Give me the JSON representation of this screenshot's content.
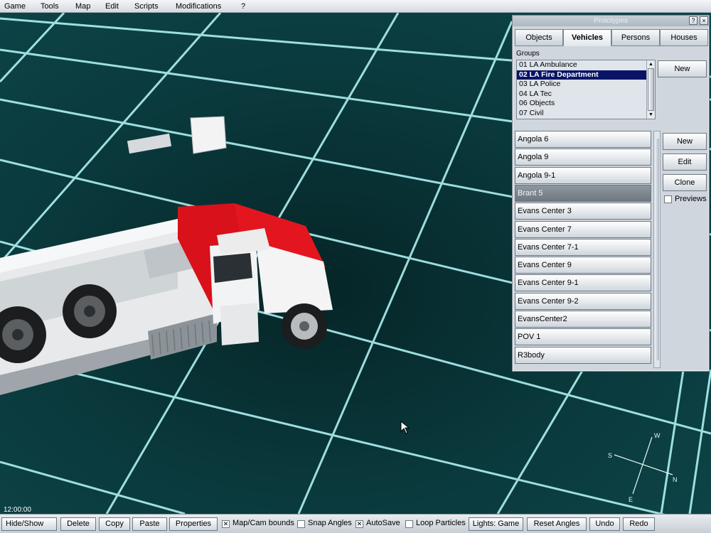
{
  "menu": [
    "Game",
    "Tools",
    "Map",
    "Edit",
    "Scripts",
    "Modifications",
    "?"
  ],
  "panel": {
    "title": "Prototypes",
    "help_glyph": "?",
    "close_glyph": "×",
    "tabs": [
      "Objects",
      "Vehicles",
      "Persons",
      "Houses"
    ],
    "active_tab": "Vehicles",
    "groups_label": "Groups",
    "groups": [
      "01 LA Ambulance",
      "02 LA Fire Department",
      "03 LA Police",
      "04 LA Tec",
      "06 Objects",
      "07 Civil"
    ],
    "selected_group": "02 LA Fire Department",
    "group_new_label": "New",
    "prototypes": [
      "Angola 6",
      "Angola 9",
      "Angola 9-1",
      "Brant 5",
      "Evans Center 3",
      "Evans Center 7",
      "Evans Center 7-1",
      "Evans Center 9",
      "Evans Center 9-1",
      "Evans Center 9-2",
      "EvansCenter2",
      "POV 1",
      "R3body"
    ],
    "selected_prototype": "Brant 5",
    "buttons": {
      "new": "New",
      "edit": "Edit",
      "clone": "Clone"
    },
    "previews_label": "Previews",
    "previews_checked": false
  },
  "status": {
    "clock": "12:00:00"
  },
  "compass": {
    "w": "W",
    "s": "S",
    "e": "E",
    "n": "N"
  },
  "toolbar": {
    "hide_show": "Hide/Show",
    "delete": "Delete",
    "copy": "Copy",
    "paste": "Paste",
    "properties": "Properties",
    "map_cam_bounds": "Map/Cam bounds",
    "map_cam_bounds_checked": true,
    "snap_angles": "Snap Angles",
    "snap_angles_checked": false,
    "autosave": "AutoSave",
    "autosave_checked": true,
    "loop_particles": "Loop Particles",
    "loop_particles_checked": false,
    "lights": "Lights: Game",
    "reset_angles": "Reset Angles",
    "undo": "Undo",
    "redo": "Redo"
  },
  "colors": {
    "grid_line": "#b8fbfd",
    "viewport_bg": "#0a3a3d",
    "selection": "#0a1466",
    "truck_cab": "#d9111a"
  }
}
